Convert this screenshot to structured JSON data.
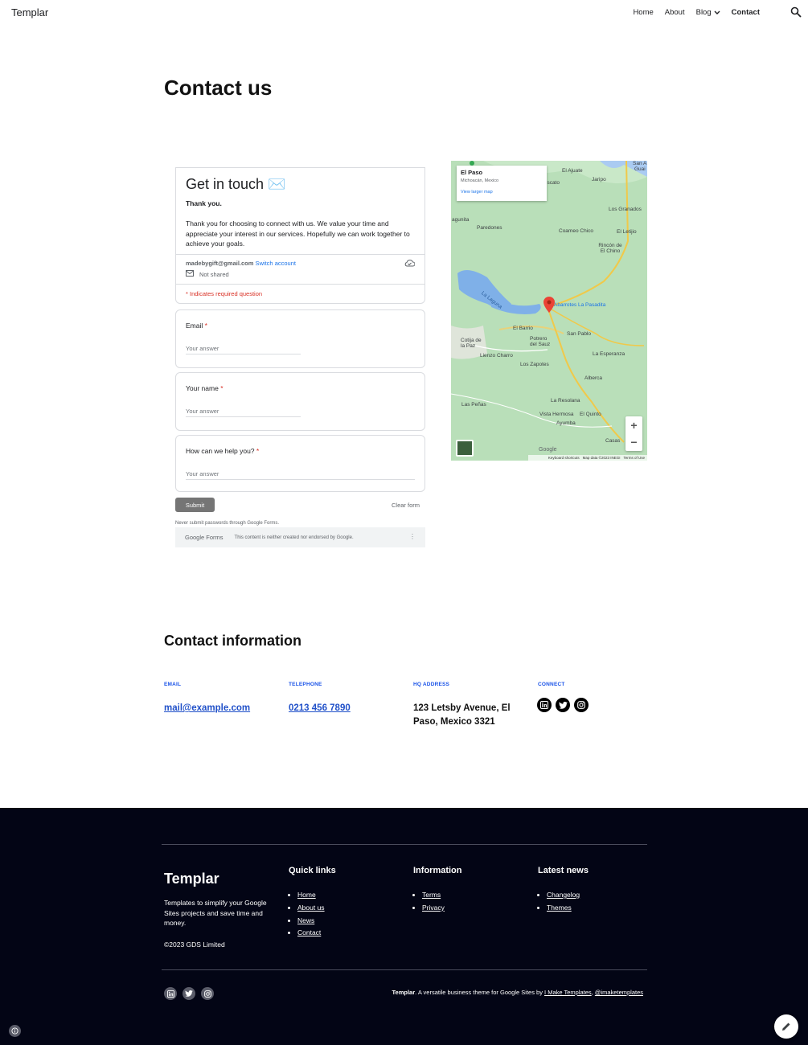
{
  "header": {
    "brand": "Templar",
    "nav": [
      {
        "label": "Home"
      },
      {
        "label": "About"
      },
      {
        "label": "Blog"
      },
      {
        "label": "Contact",
        "active": true
      }
    ]
  },
  "page_title": "Contact us",
  "form": {
    "title": "Get in touch ✉️",
    "thanks": "Thank you.",
    "description": "Thank you for choosing to connect with us. We value your time and appreciate your interest in our services. Hopefully we can work together to achieve your goals.",
    "account_email": "madebygift@gmail.com",
    "switch_account": "Switch account",
    "not_shared": "Not shared",
    "required_note": "* Indicates required question",
    "questions": [
      {
        "label": "Email",
        "required": "*",
        "placeholder": "Your answer"
      },
      {
        "label": "Your name",
        "required": "*",
        "placeholder": "Your answer"
      },
      {
        "label": "How can we help you?",
        "required": "*",
        "placeholder": "Your answer"
      }
    ],
    "submit": "Submit",
    "clear": "Clear form",
    "never_passwords": "Never submit passwords through Google Forms.",
    "forms_logo": "Google Forms",
    "disclaimer": "This content is neither created nor endorsed by Google."
  },
  "map": {
    "place": "El Paso",
    "region": "Michoacán, Mexico",
    "view_larger": "View larger map",
    "pin_label": "Abarrotes La Pasadita",
    "labels": {
      "el_ajuate": "El Ajuate",
      "jaripo": "Jaripo",
      "los_granados": "Los Granados",
      "agunita": "agunita",
      "paredones": "Paredones",
      "coameo_chico": "Coameo Chico",
      "el_letijio": "El Letijio",
      "rincon": "Rincón de El Chino",
      "la_laguna": "La Laguna",
      "el_barrio": "El Barrio",
      "san_pablo": "San Pablo",
      "cotija": "Cotija de la Paz",
      "potrero": "Potrero del Sauz",
      "lienzo_charro": "Lienzo Charro",
      "los_zapotes": "Los Zapotes",
      "la_esperanza": "La Esperanza",
      "alberca": "Alberca",
      "las_penas": "Las Peñas",
      "la_resolana": "La Resolana",
      "vista_hermosa": "Vista Hermosa",
      "el_quinto": "El Quinto",
      "ayumba": "Ayumba",
      "casas": "Casas",
      "san_a": "San A",
      "guai": "Guai",
      "iscato": "iscato"
    },
    "zoom_in": "+",
    "zoom_out": "−",
    "google": "Google",
    "footer": [
      "Keyboard shortcuts",
      "Map data ©2023 INEGI",
      "Terms of Use"
    ]
  },
  "contact_info": {
    "title": "Contact information",
    "email_label": "EMAIL",
    "email": "mail@example.com",
    "telephone_label": "TELEPHONE",
    "telephone": "0213 456 7890",
    "hq_label": "HQ ADDRESS",
    "hq": "123 Letsby Avenue, El Paso, Mexico 3321",
    "connect_label": "CONNECT",
    "social_icons": [
      "linkedin-icon",
      "twitter-icon",
      "instagram-icon"
    ]
  },
  "footer": {
    "brand": "Templar",
    "tagline": "Templates to simplify your Google Sites projects and save time and money.",
    "copyright": "©2023 GDS Limited",
    "quick_links_title": "Quick links",
    "quick_links": [
      "Home",
      "About us",
      "News",
      "Contact"
    ],
    "information_title": "Information",
    "information": [
      "Terms",
      "Privacy"
    ],
    "latest_news_title": "Latest news",
    "latest_news": [
      "Changelog",
      "Themes"
    ],
    "credit_brand": "Templar",
    "credit_text": ". A versatile business theme for Google Sites by ",
    "credit_link1": "I Make Templates",
    "credit_sep": ", ",
    "credit_link2": "@imaketemplates"
  },
  "colors": {
    "accent": "#1a53e8",
    "footer_bg": "#030515",
    "required": "#d93025"
  }
}
